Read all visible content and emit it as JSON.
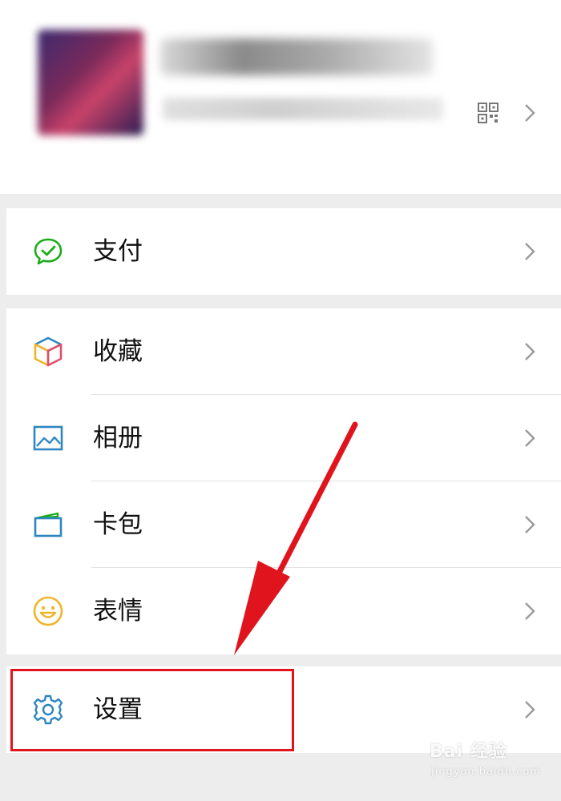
{
  "profile": {
    "nickname": "",
    "wechat_id": ""
  },
  "menu": {
    "pay": {
      "label": "支付",
      "icon": "wechat-pay-icon"
    },
    "favorites": {
      "label": "收藏",
      "icon": "cube-icon"
    },
    "album": {
      "label": "相册",
      "icon": "image-icon"
    },
    "cards": {
      "label": "卡包",
      "icon": "card-icon"
    },
    "stickers": {
      "label": "表情",
      "icon": "smiley-icon"
    },
    "settings": {
      "label": "设置",
      "icon": "gear-icon"
    }
  },
  "watermark": {
    "main": "Bai 经验",
    "sub": "jingyan.baidu.com"
  },
  "colors": {
    "accent_red": "#e0141c",
    "pay_green": "#1aad19",
    "icon_blue": "#2e86c1",
    "icon_yellow": "#f0b429"
  }
}
